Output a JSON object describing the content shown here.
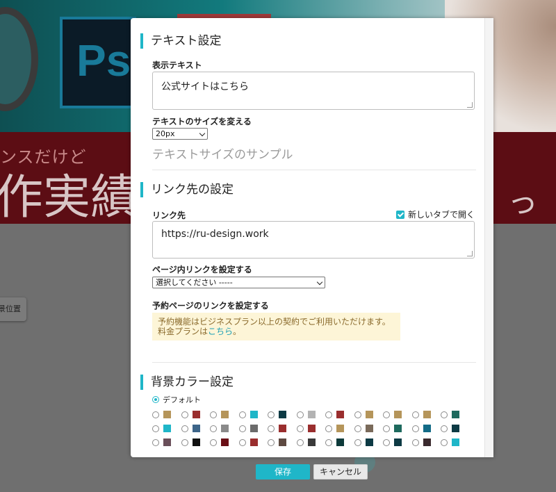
{
  "background": {
    "ps_logo": "Ps",
    "band_small_text": "ンスだけど",
    "band_big_text": "作実績",
    "band_right_text": "っ",
    "chip_label": "景位置"
  },
  "text_settings": {
    "title": "テキスト設定",
    "display_text_label": "表示テキスト",
    "display_text_value": "公式サイトはこちら",
    "size_label": "テキストのサイズを変える",
    "size_value": "20px",
    "sample": "テキストサイズのサンプル"
  },
  "link_settings": {
    "title": "リンク先の設定",
    "link_label": "リンク先",
    "new_tab_label": "新しいタブで開く",
    "new_tab_checked": true,
    "link_value": "https://ru-design.work",
    "page_link_label": "ページ内リンクを設定する",
    "page_link_value": "選択してください -----",
    "booking_label": "予約ページのリンクを設定する",
    "notice_line1": "予約機能はビジネスプラン以上の契約でご利用いただけます。",
    "notice_line2_pre": "料金プランは",
    "notice_link": "こちら",
    "notice_line2_post": "。"
  },
  "bg_color": {
    "title": "背景カラー設定",
    "default_label": "デフォルト",
    "swatch_rows": [
      [
        "#b5955a",
        "#9a2e2e",
        "#b5955a",
        "#1fb6c8",
        "#0d3a44",
        "#b3b3b3",
        "#9a2e2e",
        "#b5955a",
        "#b5955a",
        "#b5955a",
        "#1e6a5e"
      ],
      [
        "#1fb6c8",
        "#3d6589",
        "#8a8a8a",
        "#6b6b6b",
        "#9a2e2e",
        "#9a2e2e",
        "#b5955a",
        "#7a6a5a",
        "#1e6a5e",
        "#136b87",
        "#0d3a44"
      ],
      [
        "#6a4f5a",
        "#111111",
        "#6a0f16",
        "#9a2e2e",
        "#5e4a42",
        "#3a3a3a",
        "#0d3a3a",
        "#0d3a44",
        "#0d3a44",
        "#3a2a2e",
        "#1fb6c8"
      ]
    ]
  },
  "footer": {
    "save": "保存",
    "cancel": "キャンセル"
  }
}
